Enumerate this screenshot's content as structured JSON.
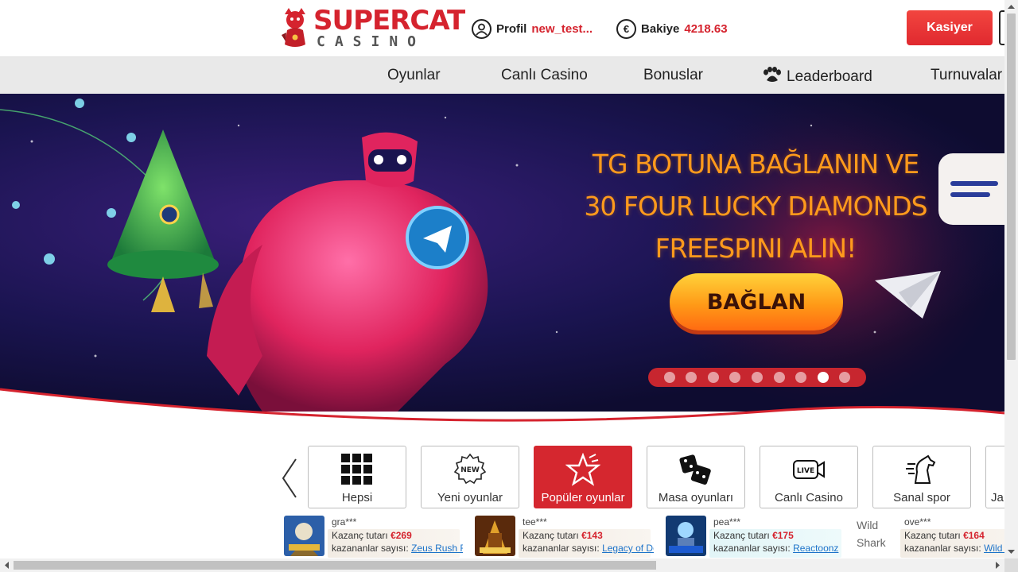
{
  "brand": {
    "name_top": "SUPERCAT",
    "name_bottom": "CASINO"
  },
  "header": {
    "profile_label": "Profil",
    "profile_value": "new_test...",
    "balance_label": "Bakiye",
    "balance_value": "4218.63",
    "currency_icon": "€",
    "cashier_label": "Kasiyer"
  },
  "nav": {
    "items": [
      {
        "label": "Oyunlar"
      },
      {
        "label": "Canlı Casino"
      },
      {
        "label": "Bonuslar"
      },
      {
        "label": "Leaderboard",
        "icon": "paw-icon"
      },
      {
        "label": "Turnuvalar"
      }
    ]
  },
  "banner": {
    "title_line1": "TG BOTUNA BAĞLANIN VE",
    "title_line2": "30 FOUR LUCKY DIAMONDS",
    "title_line3": "FREESPINI ALIN!",
    "button_label": "BAĞLAN",
    "slides_total": 9,
    "active_slide": 8
  },
  "categories": [
    {
      "label": "Hepsi",
      "icon": "grid-icon"
    },
    {
      "label": "Yeni oyunlar",
      "icon": "new-badge-icon"
    },
    {
      "label": "Popüler oyunlar",
      "icon": "star-icon",
      "active": true
    },
    {
      "label": "Masa oyunları",
      "icon": "dice-icon"
    },
    {
      "label": "Canlı Casino",
      "icon": "live-icon"
    },
    {
      "label": "Sanal spor",
      "icon": "horse-icon"
    },
    {
      "label": "Ja",
      "icon": "jackpot-icon"
    }
  ],
  "winners": [
    {
      "user": "gra***",
      "amount_label": "Kazanç tutarı",
      "amount": "€269",
      "count_label": "kazananlar sayısı:",
      "game": "Zeus Rush F..."
    },
    {
      "user": "tee***",
      "amount_label": "Kazanç tutarı",
      "amount": "€143",
      "count_label": "kazananlar sayısı:",
      "game": "Legacy of De..."
    },
    {
      "user": "pea***",
      "amount_label": "Kazanç tutarı",
      "amount": "€175",
      "count_label": "kazananlar sayısı:",
      "game": "Reactoonz"
    },
    {
      "user": "ove***",
      "amount_label": "Kazanç tutarı",
      "amount": "€164",
      "count_label": "kazananlar sayısı:",
      "game": "Wild S",
      "broken_image_alt": "Wild Shark"
    }
  ],
  "colors": {
    "brand_red": "#d5232e",
    "banner_orange": "#ff9a1c",
    "nav_bg": "#e9e9e9"
  }
}
